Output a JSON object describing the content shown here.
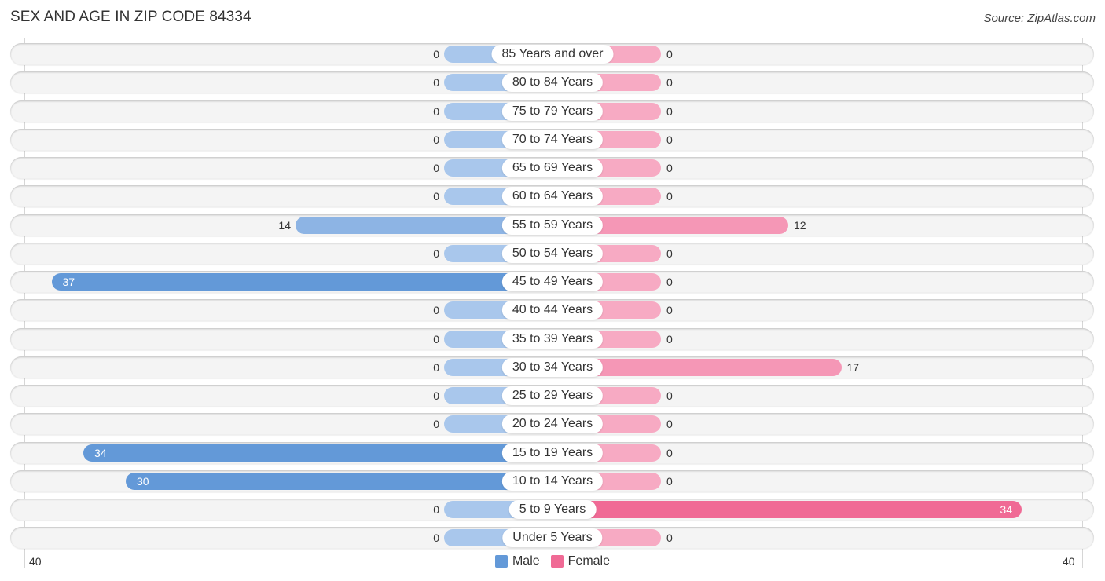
{
  "title": "SEX AND AGE IN ZIP CODE 84334",
  "source": "Source: ZipAtlas.com",
  "colors": {
    "male_strong": "#6399d8",
    "male_light": "#a9c7ec",
    "female_strong": "#f06a95",
    "female_light": "#f7aac3"
  },
  "chart_data": {
    "type": "bar",
    "orientation": "horizontal-diverging",
    "title": "SEX AND AGE IN ZIP CODE 84334",
    "categories": [
      "85 Years and over",
      "80 to 84 Years",
      "75 to 79 Years",
      "70 to 74 Years",
      "65 to 69 Years",
      "60 to 64 Years",
      "55 to 59 Years",
      "50 to 54 Years",
      "45 to 49 Years",
      "40 to 44 Years",
      "35 to 39 Years",
      "30 to 34 Years",
      "25 to 29 Years",
      "20 to 24 Years",
      "15 to 19 Years",
      "10 to 14 Years",
      "5 to 9 Years",
      "Under 5 Years"
    ],
    "series": [
      {
        "name": "Male",
        "values": [
          0,
          0,
          0,
          0,
          0,
          0,
          14,
          0,
          37,
          0,
          0,
          0,
          0,
          0,
          34,
          30,
          0,
          0
        ]
      },
      {
        "name": "Female",
        "values": [
          0,
          0,
          0,
          0,
          0,
          0,
          12,
          0,
          0,
          0,
          0,
          17,
          0,
          0,
          0,
          0,
          34,
          0
        ]
      }
    ],
    "axis": {
      "left_tick": "40",
      "right_tick": "40",
      "range": [
        0,
        40
      ]
    },
    "legend": {
      "position": "bottom-center",
      "items": [
        "Male",
        "Female"
      ]
    },
    "xlabel": "",
    "ylabel": ""
  }
}
